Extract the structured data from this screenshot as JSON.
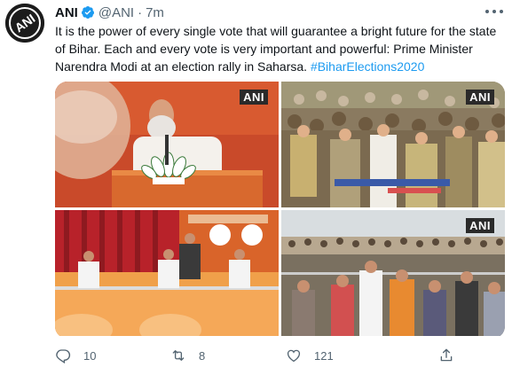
{
  "tweet": {
    "author_name": "ANI",
    "handle": "@ANI",
    "separator": "·",
    "time": "7m",
    "text_main": "It is the power of every single vote that will guarantee a bright future for the state of Bihar. Each and every vote is very important and powerful: Prime Minister Narendra Modi at an election rally in Saharsa.",
    "hashtag": "#BiharElections2020",
    "avatar_label": "ANI"
  },
  "media": [
    {
      "watermark": "ANI"
    },
    {
      "watermark": "ANI"
    },
    {
      "watermark": ""
    },
    {
      "watermark": "ANI"
    }
  ],
  "actions": {
    "replies": "10",
    "retweets": "8",
    "likes": "121"
  },
  "colors": {
    "accent": "#1d9bf0",
    "secondary_text": "#536471",
    "primary_text": "#0f1419"
  },
  "icons": [
    "verified-badge-icon",
    "more-options-icon",
    "reply-icon",
    "retweet-icon",
    "like-icon",
    "share-icon"
  ]
}
